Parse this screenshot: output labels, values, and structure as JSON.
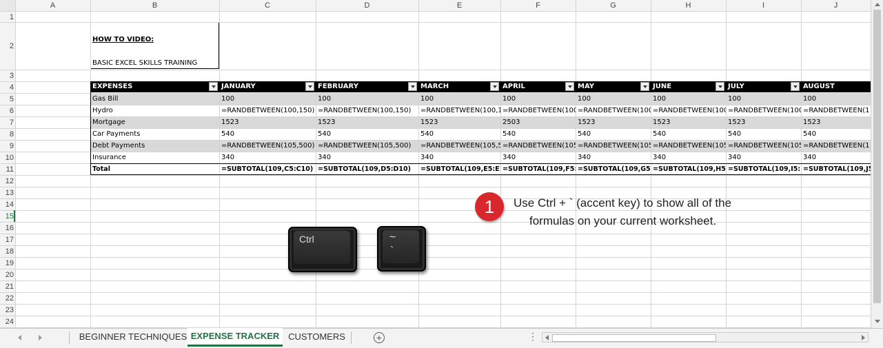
{
  "columns": [
    "A",
    "B",
    "C",
    "D",
    "E",
    "F",
    "G",
    "H",
    "I",
    "J"
  ],
  "rows": [
    "1",
    "2",
    "3",
    "4",
    "5",
    "6",
    "7",
    "8",
    "9",
    "10",
    "11",
    "12",
    "13",
    "14",
    "15",
    "16",
    "17",
    "18",
    "19",
    "20",
    "21",
    "22",
    "23",
    "24"
  ],
  "how_to": {
    "title": "HOW TO VIDEO:",
    "subtitle": "BASIC EXCEL SKILLS TRAINING"
  },
  "table": {
    "headers": [
      "EXPENSES",
      "JANUARY",
      "FEBRUARY",
      "MARCH",
      "APRIL",
      "MAY",
      "JUNE",
      "JULY",
      "AUGUST"
    ],
    "rows": [
      [
        "Gas Bill",
        "100",
        "100",
        "100",
        "100",
        "100",
        "100",
        "100",
        "100"
      ],
      [
        "Hydro",
        "=RANDBETWEEN(100,150)",
        "=RANDBETWEEN(100,150)",
        "=RANDBETWEEN(100,1",
        "=RANDBETWEEN(100",
        "=RANDBETWEEN(100",
        "=RANDBETWEEN(100",
        "=RANDBETWEEN(100",
        "=RANDBETWEEN(1"
      ],
      [
        "Mortgage",
        "1523",
        "1523",
        "1523",
        "2503",
        "1523",
        "1523",
        "1523",
        "1523"
      ],
      [
        "Car Payments",
        "540",
        "540",
        "540",
        "540",
        "540",
        "540",
        "540",
        "540"
      ],
      [
        "Debt Payments",
        "=RANDBETWEEN(105,500)",
        "=RANDBETWEEN(105,500)",
        "=RANDBETWEEN(105,5",
        "=RANDBETWEEN(105",
        "=RANDBETWEEN(105",
        "=RANDBETWEEN(105",
        "=RANDBETWEEN(105",
        "=RANDBETWEEN(1"
      ],
      [
        "Insurance",
        "340",
        "340",
        "340",
        "340",
        "340",
        "340",
        "340",
        "340"
      ]
    ],
    "total": [
      "Total",
      "=SUBTOTAL(109,C5:C10)",
      "=SUBTOTAL(109,D5:D10)",
      "=SUBTOTAL(109,E5:E10",
      "=SUBTOTAL(109,F5:F",
      "=SUBTOTAL(109,G5:G",
      "=SUBTOTAL(109,H5:H",
      "=SUBTOTAL(109,I5:I1",
      "=SUBTOTAL(109,J5"
    ]
  },
  "callout": {
    "number": "1",
    "line1": "Use Ctrl + ` (accent key) to show all of the",
    "line2": "formulas on your current worksheet."
  },
  "keys": {
    "ctrl": "Ctrl",
    "tilde_top": "~",
    "tilde_bottom": "`"
  },
  "tabs": [
    "BEGINNER TECHNIQUES",
    "EXPENSE TRACKER",
    "CUSTOMERS"
  ],
  "active_tab": "EXPENSE TRACKER",
  "active_row": "15",
  "colors": {
    "accent": "#217346",
    "callout": "#d9272e",
    "band": "#d9d9d9"
  }
}
